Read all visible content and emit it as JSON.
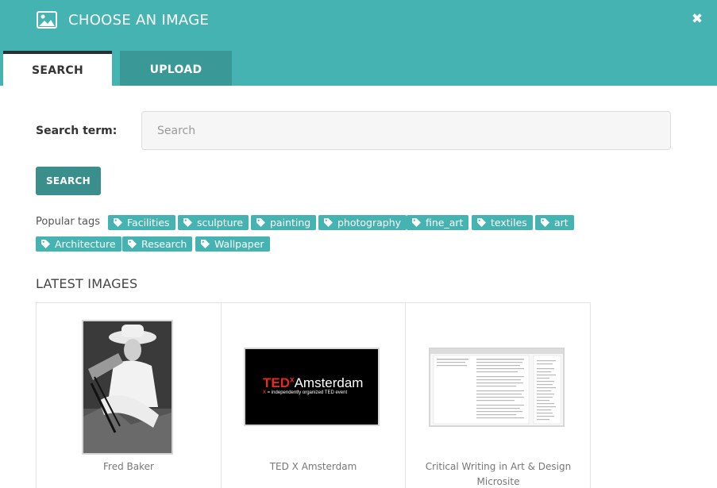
{
  "header": {
    "title": "CHOOSE AN IMAGE",
    "icon": "image-icon",
    "close_icon": "close-icon",
    "close_glyph": "✖"
  },
  "tabs": [
    {
      "label": "SEARCH",
      "active": true
    },
    {
      "label": "UPLOAD",
      "active": false
    }
  ],
  "search": {
    "label": "Search term:",
    "placeholder": "Search",
    "value": "",
    "button_label": "SEARCH"
  },
  "popular_tags": {
    "label": "Popular tags",
    "tags": [
      "Facilities",
      "sculpture",
      "painting",
      "photography",
      "fine_art",
      "textiles",
      "art",
      "Architecture",
      "Research",
      "Wallpaper"
    ]
  },
  "latest_images": {
    "title": "LATEST IMAGES",
    "items": [
      {
        "caption": "Fred Baker"
      },
      {
        "caption": "TED X Amsterdam",
        "thumb_brand": "TED",
        "thumb_sup": "x",
        "thumb_city": "Amsterdam",
        "thumb_sub_mark": "X",
        "thumb_sub": " = independently organized TED event"
      },
      {
        "caption": "Critical Writing in Art & Design Microsite"
      }
    ]
  },
  "colors": {
    "header": "#45b3b1",
    "tab_inactive": "#3a9896",
    "button": "#3a8e8c",
    "tag": "#45b3b1",
    "ted_red": "#e62b1e"
  }
}
